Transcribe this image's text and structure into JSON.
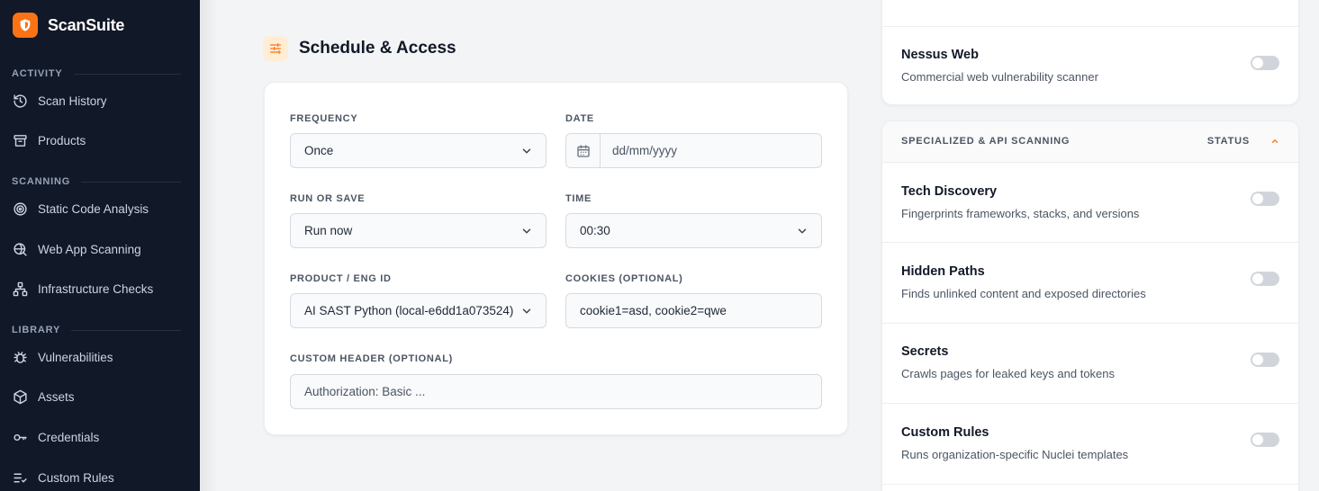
{
  "brand": {
    "name": "ScanSuite"
  },
  "sidebar": {
    "sections": [
      {
        "label": "ACTIVITY"
      },
      {
        "label": "SCANNING"
      },
      {
        "label": "LIBRARY"
      }
    ],
    "items": [
      {
        "label": "Scan History",
        "icon": "history-icon"
      },
      {
        "label": "Products",
        "icon": "archive-icon"
      },
      {
        "label": "Static Code Analysis",
        "icon": "target-icon"
      },
      {
        "label": "Web App Scanning",
        "icon": "web-scan-icon"
      },
      {
        "label": "Infrastructure Checks",
        "icon": "network-icon"
      },
      {
        "label": "Vulnerabilities",
        "icon": "bug-icon"
      },
      {
        "label": "Assets",
        "icon": "cube-icon"
      },
      {
        "label": "Credentials",
        "icon": "key-icon"
      },
      {
        "label": "Custom Rules",
        "icon": "list-check-icon"
      }
    ]
  },
  "schedule": {
    "title": "Schedule & Access",
    "icon": "sliders-icon",
    "frequency": {
      "label": "FREQUENCY",
      "value": "Once"
    },
    "date": {
      "label": "DATE",
      "placeholder": "dd/mm/yyyy"
    },
    "run_or_save": {
      "label": "RUN OR SAVE",
      "value": "Run now"
    },
    "time": {
      "label": "TIME",
      "value": "00:30"
    },
    "product": {
      "label": "PRODUCT / ENG ID",
      "value": "AI SAST Python (local-e6dd1a073524)"
    },
    "cookies": {
      "label": "COOKIES (OPTIONAL)",
      "value": "cookie1=asd, cookie2=qwe"
    },
    "custom_header": {
      "label": "CUSTOM HEADER (OPTIONAL)",
      "value": "Authorization: Basic ..."
    }
  },
  "web_scanners": {
    "items": [
      {
        "title": "Nessus Web",
        "desc": "Commercial web vulnerability scanner",
        "enabled": false
      }
    ]
  },
  "specialized": {
    "title": "SPECIALIZED & API SCANNING",
    "status_label": "STATUS",
    "items": [
      {
        "title": "Tech Discovery",
        "desc": "Fingerprints frameworks, stacks, and versions",
        "enabled": false
      },
      {
        "title": "Hidden Paths",
        "desc": "Finds unlinked content and exposed directories",
        "enabled": false
      },
      {
        "title": "Secrets",
        "desc": "Crawls pages for leaked keys and tokens",
        "enabled": false
      },
      {
        "title": "Custom Rules",
        "desc": "Runs organization-specific Nuclei templates",
        "enabled": false
      }
    ]
  },
  "colors": {
    "accent": "#f97316",
    "sidebar_bg": "#111827",
    "page_bg": "#f3f4f6"
  }
}
